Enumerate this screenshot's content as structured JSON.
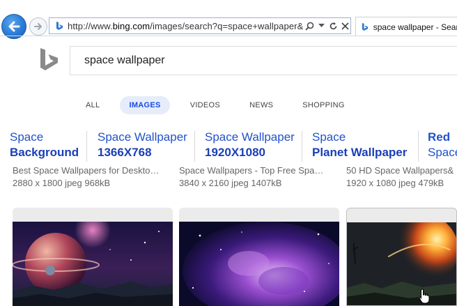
{
  "browser": {
    "url_prefix": "http://www.",
    "url_domain": "bing.com",
    "url_rest": "/images/search?q=space+wallpaper&FOR",
    "tab_title": "space wallpaper - Search",
    "icons": {
      "back": "back-arrow-icon",
      "forward": "forward-arrow-icon",
      "search": "search-icon",
      "dropdown": "chevron-down-icon",
      "refresh": "refresh-icon",
      "stop": "close-icon"
    }
  },
  "search": {
    "query": "space wallpaper"
  },
  "nav": {
    "tabs": [
      {
        "label": "ALL",
        "active": false
      },
      {
        "label": "IMAGES",
        "active": true
      },
      {
        "label": "VIDEOS",
        "active": false
      },
      {
        "label": "NEWS",
        "active": false
      },
      {
        "label": "SHOPPING",
        "active": false
      }
    ]
  },
  "related": [
    {
      "line1": "Space",
      "line2": "Background"
    },
    {
      "line1": "Space Wallpaper",
      "line2": "1366X768"
    },
    {
      "line1": "Space Wallpaper",
      "line2": "1920X1080"
    },
    {
      "line1": "Space",
      "line2": "Planet Wallpaper"
    },
    {
      "line1": "Red",
      "line2": "Space"
    }
  ],
  "results_meta": [
    {
      "title": "Best Space Wallpapers for Deskto…",
      "info": "2880 x 1800 jpeg 968kB"
    },
    {
      "title": "Space Wallpapers - Top Free Spa…",
      "info": "3840 x 2160 jpeg 1407kB"
    },
    {
      "title": "50 HD Space Wallpapers&",
      "info": "1920 x 1080 jpeg 479kB"
    }
  ],
  "colors": {
    "link_blue": "#2052c9",
    "link_bold_blue": "#1a3fb7",
    "active_tab_bg": "#e6ecfa",
    "active_tab_text": "#174ae4",
    "bing_logo": "#8a8a8a"
  }
}
